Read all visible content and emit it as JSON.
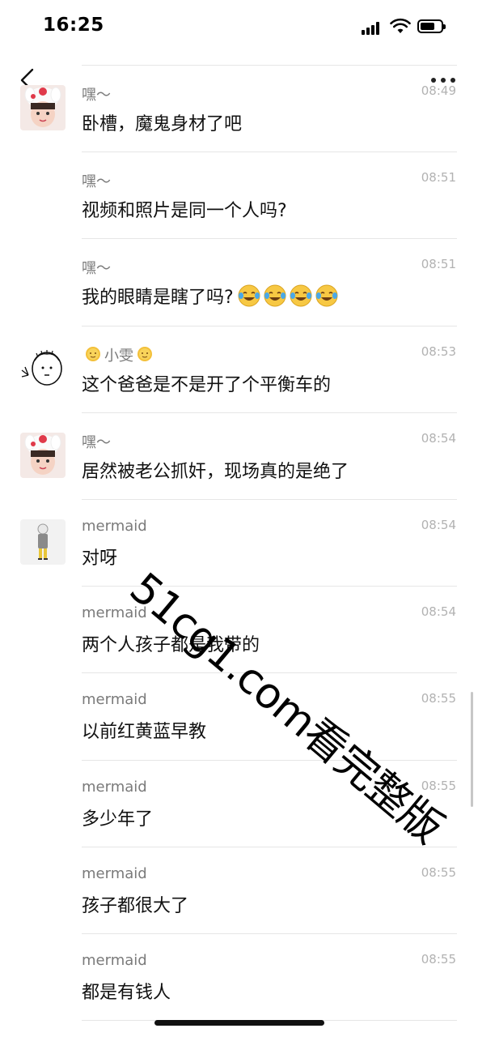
{
  "status_bar": {
    "time": "16:25",
    "battery_level": 0.7
  },
  "nav": {
    "back_icon": "chevron-left-icon",
    "more_icon": "more-dots-icon"
  },
  "comments": [
    {
      "name": "嘿～",
      "time": "08:49",
      "text": "卧槽，魔鬼身材了吧",
      "avatar": "girl-bunny-hat"
    },
    {
      "name": "嘿～",
      "time": "08:51",
      "text": "视频和照片是同一个人吗?",
      "avatar": ""
    },
    {
      "name": "嘿～",
      "time": "08:51",
      "text": "我的眼睛是瞎了吗?",
      "avatar": "",
      "emoji": "crying-laughing-emoji",
      "emoji_count": 4
    },
    {
      "name": "小雯",
      "time": "08:53",
      "text": "这个爸爸是不是开了个平衡车的",
      "avatar": "doodle-face",
      "name_icon": "sun-icon"
    },
    {
      "name": "嘿～",
      "time": "08:54",
      "text": "居然被老公抓奸，现场真的是绝了",
      "avatar": "girl-bunny-hat"
    },
    {
      "name": "mermaid",
      "time": "08:54",
      "text": "对呀",
      "avatar": "cartoon-boy"
    },
    {
      "name": "mermaid",
      "time": "08:54",
      "text": "两个人孩子都是我带的",
      "avatar": ""
    },
    {
      "name": "mermaid",
      "time": "08:55",
      "text": "以前红黄蓝早教",
      "avatar": ""
    },
    {
      "name": "mermaid",
      "time": "08:55",
      "text": "多少年了",
      "avatar": ""
    },
    {
      "name": "mermaid",
      "time": "08:55",
      "text": "孩子都很大了",
      "avatar": ""
    },
    {
      "name": "mermaid",
      "time": "08:55",
      "text": "都是有钱人",
      "avatar": ""
    }
  ],
  "watermark": "51cg1.com看完整版"
}
